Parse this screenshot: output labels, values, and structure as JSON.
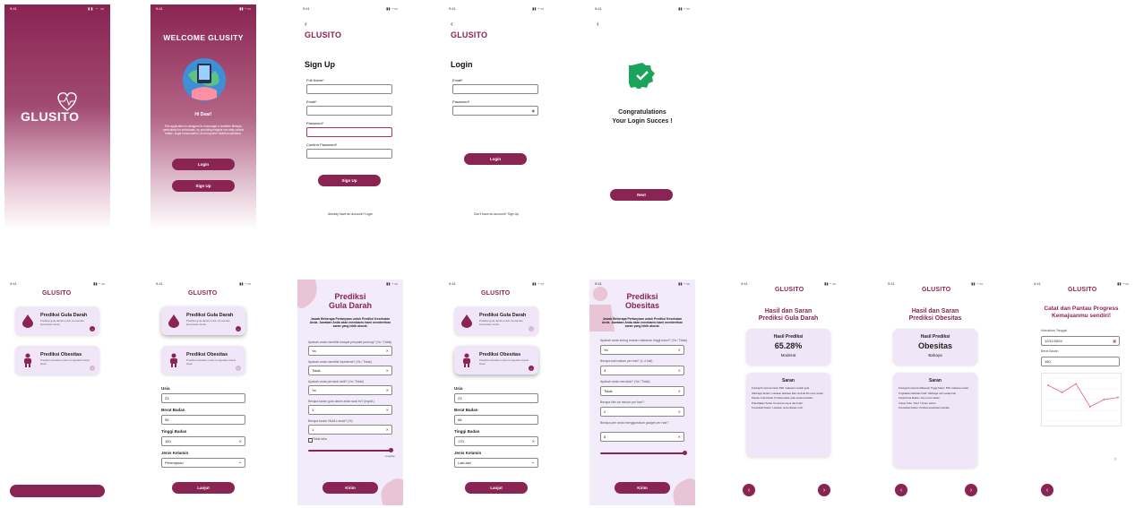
{
  "brand": "GLUSITO",
  "colors": {
    "primary": "#8a2452",
    "lilac": "#f1ebfa",
    "success": "#1aa35a"
  },
  "status_time": "9:41",
  "splash": {
    "logo": "GLUSITO"
  },
  "welcome": {
    "title": "WELCOME  GLUSITY",
    "greeting": "Hi Dear!",
    "desc": "This application is designed to encourage a healthier lifestyle, particularly for individuals, by providing insights into daily calorie intake, sugar consumption, and long-term health projections.",
    "login": "Login",
    "signup": "Sign Up"
  },
  "signup": {
    "title": "Sign Up",
    "fullname": "Full Name*",
    "email": "Email*",
    "password": "Password*",
    "confirm": "Confirm Password*",
    "button": "Sign Up",
    "footer": "Already have an account? Login"
  },
  "login": {
    "title": "Login",
    "email": "Email*",
    "password": "Password*",
    "button": "Login",
    "footer": "Don't have an account? Sign Up"
  },
  "success": {
    "line1": "Congratulations",
    "line2": "Your Login Succes !",
    "button": "Next"
  },
  "menu": {
    "gula_title": "Prediksi Gula Darah",
    "gula_sub": "Prediksi gula darah untuk memantau kesehatan Anda.",
    "obes_title": "Prediksi Obesitas",
    "obes_sub": "Prediksi obesitas untuk mengetahui berat ideal."
  },
  "form": {
    "usia": "Usia",
    "usia_val": "23",
    "berat": "Berat Badan",
    "berat_val": "55",
    "tinggi": "Tinggi Badan",
    "tinggi_val": "160",
    "kelamin": "Jenis Kelamin",
    "kelamin_val": "Perempuan",
    "kelamin_val2": "Laki-laki",
    "usia_val2": "23",
    "berat_val2": "68",
    "tinggi_val2": "170",
    "button": "Lanjut"
  },
  "gula_q": {
    "title1": "Prediksi",
    "title2": "Gula Darah",
    "intro": "Jawab Beberapa Pertanyaan untuk Prediksi Kesehatan Anda. Jawaban Anda akan membantu kami memberikan saran yang lebih akurat.",
    "q1": "Apakah anda memiliki riwayat penyakit jantung? (Ya / Tidak)",
    "a1": "Ya",
    "q2": "Apakah anda memiliki hipertensi? (Ya / Tidak)",
    "a2": "Tidak",
    "q3": "Apakah anda perokok aktif? (Ya / Tidak)",
    "a3": "Ya",
    "q4": "Berapa kadar gula darah anda saat ini? (mg/dL)",
    "a4": "1",
    "q5": "Berapa kadar HbA1c anda? (%)",
    "a5": "1",
    "check": "Tidak tahu",
    "slider_label": "Lengkap",
    "button": "Kirim"
  },
  "obes_q": {
    "title1": "Prediksi",
    "title2": "Obesitas",
    "intro": "Jawab Beberapa Pertanyaan untuk Prediksi Kesehatan Anda. Jawaban Anda akan membantu kami memberikan saran yang lebih akurat.",
    "q1": "Apakah anda sering makan makanan tinggi kalori? (Ya / Tidak)",
    "a1": "Ya",
    "q2": "Berapa kali makan per hari? (1-4 kali)",
    "a2": "3",
    "q3": "Apakah anda merokok? (Ya / Tidak)",
    "a3": "Tidak",
    "q4": "Berapa liter air minum per hari?",
    "a4": "2",
    "q5": "Berapa jam anda menggunakan gadget per hari?",
    "a5": "8",
    "button": "Kirim"
  },
  "result_gula": {
    "title1": "Hasil dan Saran",
    "title2": "Prediksi Gula Darah",
    "card_label": "Hasil Prediksi",
    "value": "65.28%",
    "level": "Moderat",
    "saran": "Saran",
    "items": [
      "Kurangi Konsumsi Gula: Pilih makanan rendah gula.",
      "Olahraga Teratur: Lakukan aktivitas fisik minimal 30 menit sehari.",
      "Pantau Gula Darah: Periksa kadar gula secara berkala.",
      "Pola Makan Sehat: Konsumsi sayur dan buah.",
      "Konsultasi Dokter: Lakukan pemeriksaan rutin."
    ]
  },
  "result_obes": {
    "title1": "Hasil dan Saran",
    "title2": "Prediksi Obesitas",
    "card_label": "Hasil Prediksi",
    "value": "Obesitas",
    "level": "Bahaya",
    "saran": "Saran",
    "items": [
      "Kurangi Konsumsi Makanan Tinggi Kalori: Pilih makanan sehat.",
      "Tingkatkan Aktivitas Fisik: Olahraga rutin setiap hari.",
      "Kelola Pola Makan: Atur porsi makan.",
      "Cukup Tidur: Tidur 7-8 jam sehari.",
      "Konsultasi Dokter: Periksa kesehatan berkala."
    ]
  },
  "progress": {
    "title1": "Catat dan Pantau Progress",
    "title2": "Kemajuanmu sendiri!",
    "date_label": "Masukkan Tanggal",
    "date_val": "12/11/2024",
    "weight_label": "Berat Badan",
    "weight_val": "150"
  },
  "chart_data": {
    "type": "line",
    "x": [
      1,
      2,
      3,
      4,
      5,
      6
    ],
    "values": [
      90,
      80,
      92,
      60,
      70,
      73
    ],
    "ylim": [
      40,
      100
    ]
  }
}
